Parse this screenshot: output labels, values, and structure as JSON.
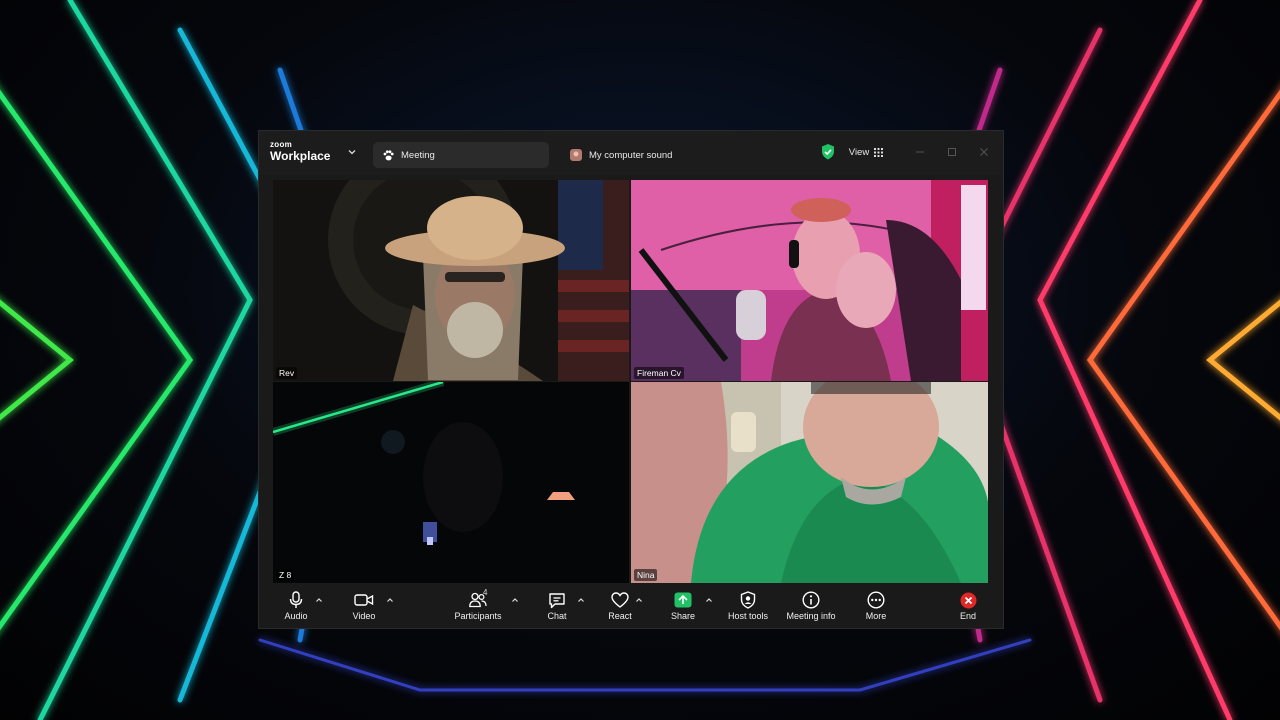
{
  "window": {
    "logo_small": "zoom",
    "logo_main": "Workplace",
    "tabs": [
      {
        "label": "Meeting",
        "icon": "paw-icon"
      },
      {
        "label": "My computer sound",
        "icon": "sound-avatar-icon"
      }
    ],
    "view_label": "View",
    "colors": {
      "accent_green": "#3ed37a",
      "end_red": "#e02828",
      "share_green": "#23c165"
    }
  },
  "participants": [
    {
      "name": "Rev"
    },
    {
      "name": "Fireman Cv"
    },
    {
      "name": "Z 8"
    },
    {
      "name": "Nina",
      "active_speaker": true
    }
  ],
  "toolbar": {
    "audio": "Audio",
    "video": "Video",
    "participants": "Participants",
    "participants_count": "4",
    "chat": "Chat",
    "react": "React",
    "share": "Share",
    "host_tools": "Host tools",
    "meeting_info": "Meeting info",
    "more": "More",
    "end": "End"
  }
}
